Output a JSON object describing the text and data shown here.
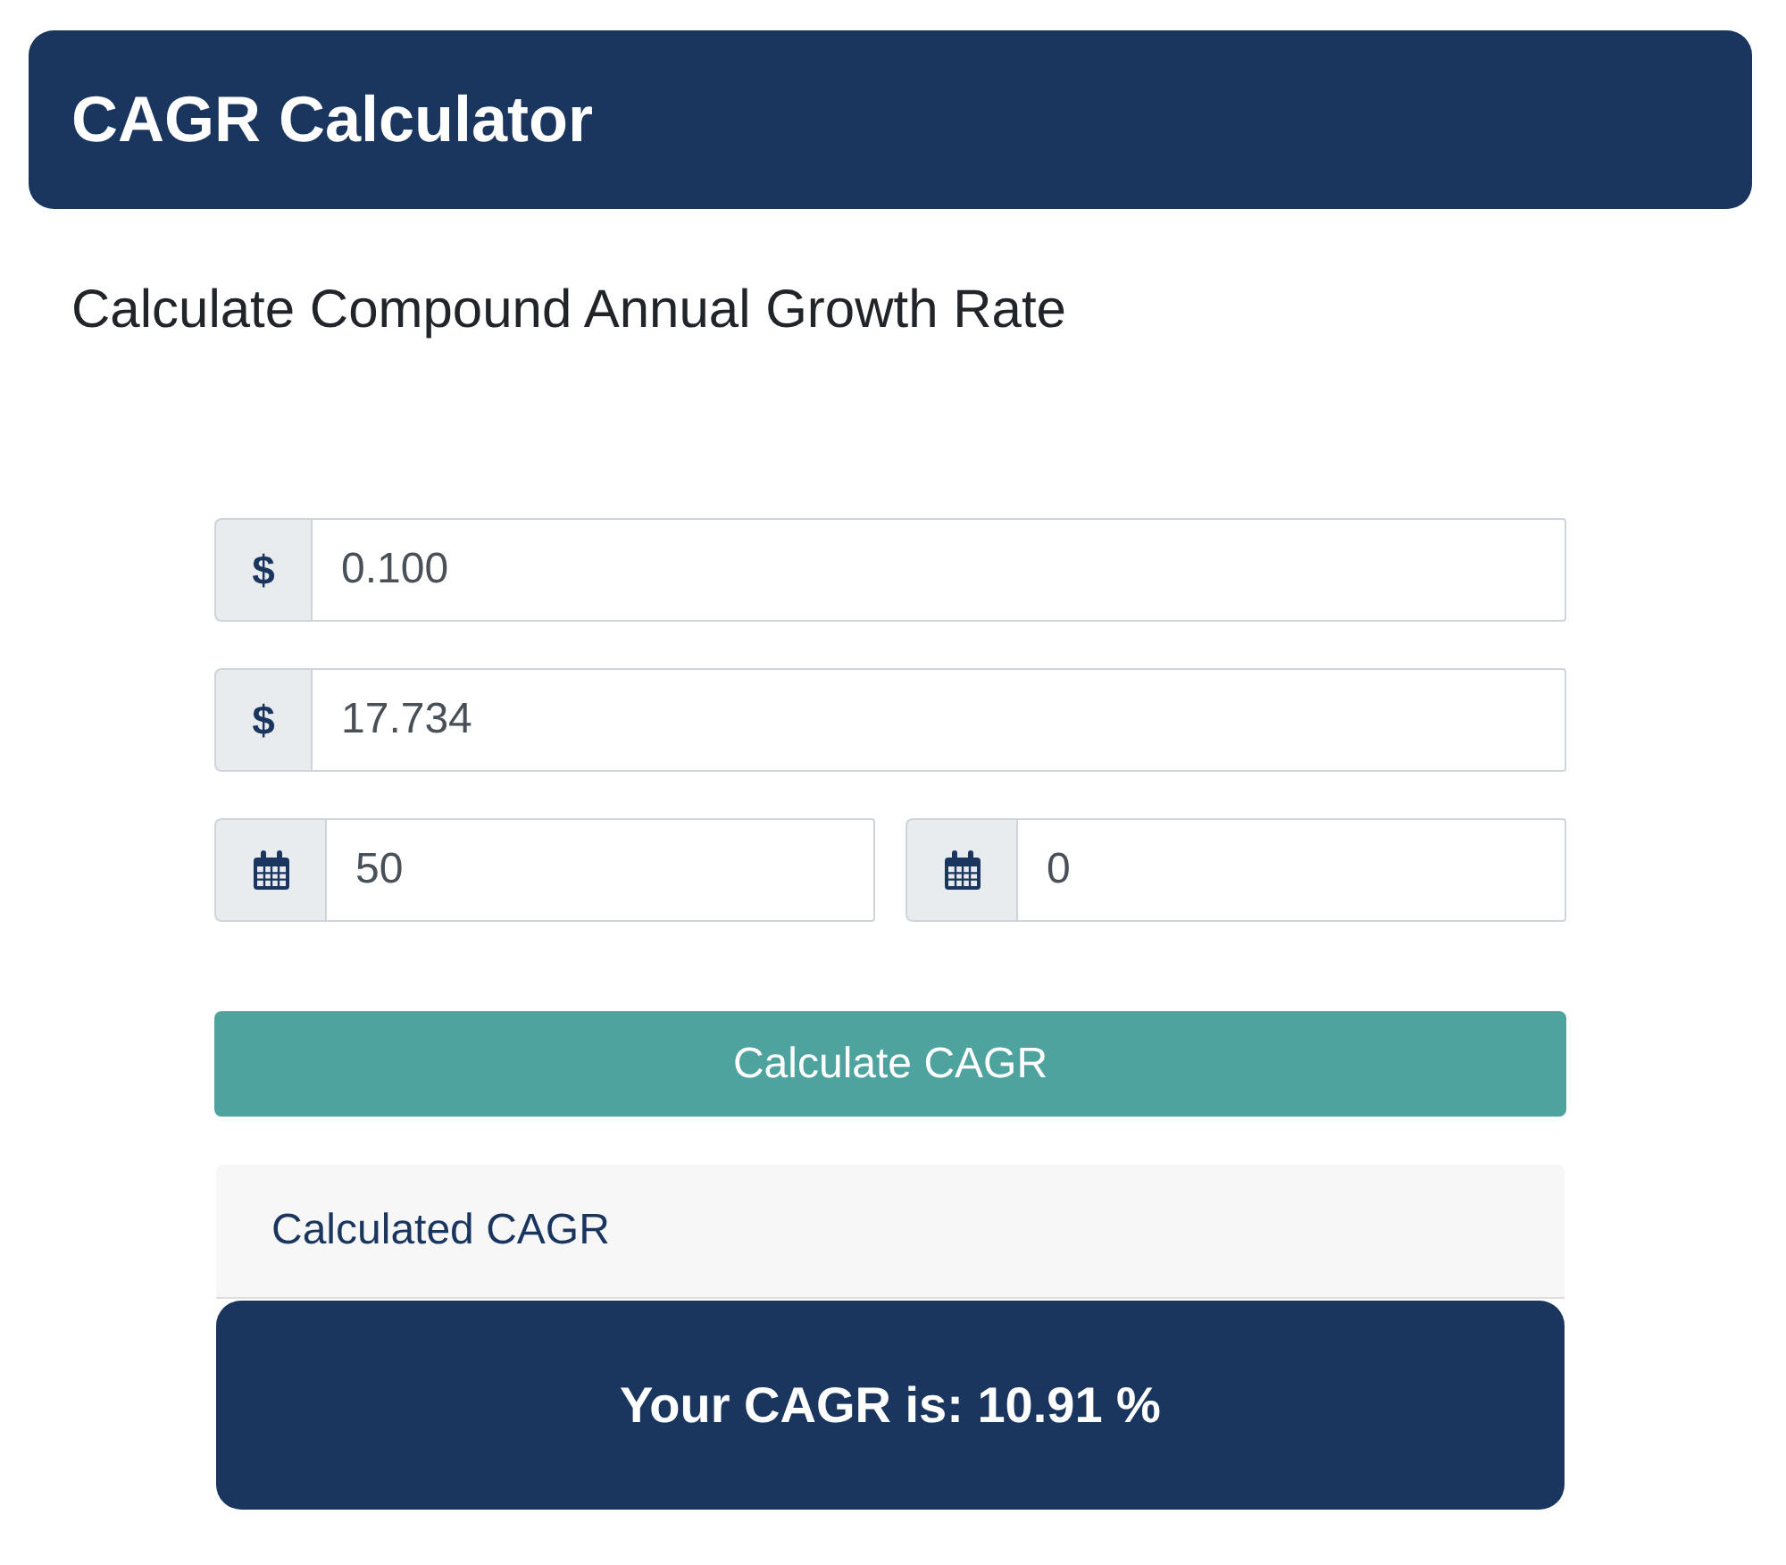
{
  "header": {
    "title": "CAGR Calculator"
  },
  "subtitle": "Calculate Compound Annual Growth Rate",
  "field_rows": [
    {
      "fields": [
        {
          "kind": "currency",
          "prefix": "$",
          "value": "0.100"
        }
      ]
    },
    {
      "fields": [
        {
          "kind": "currency",
          "prefix": "$",
          "value": "17.734"
        }
      ]
    },
    {
      "fields": [
        {
          "kind": "calendar",
          "value": "50"
        },
        {
          "kind": "calendar",
          "value": "0"
        }
      ]
    }
  ],
  "button": {
    "label": "Calculate CAGR"
  },
  "result": {
    "heading": "Calculated CAGR",
    "text": "Your CAGR is: 10.91 %"
  }
}
